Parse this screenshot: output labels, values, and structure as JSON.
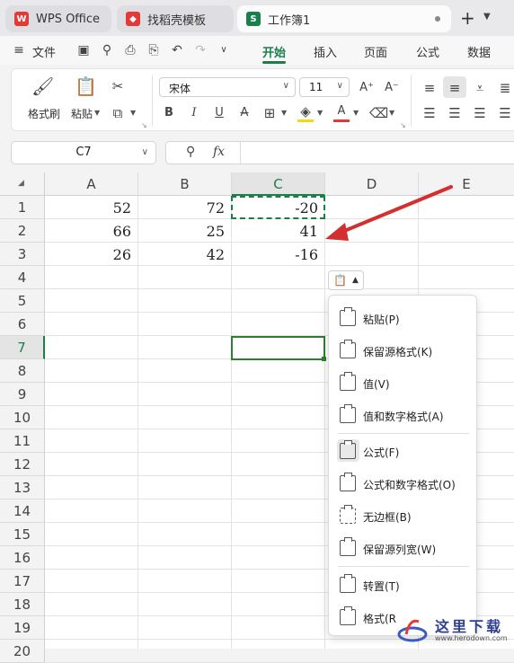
{
  "tabs": {
    "wps": "WPS Office",
    "template": "找稻壳模板",
    "workbook": "工作簿1",
    "workbook_logo": "S"
  },
  "menu": {
    "file": "文件",
    "items": [
      "开始",
      "插入",
      "页面",
      "公式",
      "数据"
    ],
    "active": "开始"
  },
  "ribbon": {
    "format_painter": "格式刷",
    "paste": "粘贴",
    "font_name": "宋体",
    "font_size": "11",
    "bold": "B",
    "italic": "I",
    "underline": "U",
    "strike": "A",
    "font_color_glyph": "A",
    "grow_font": "A⁺",
    "shrink_font": "A⁻"
  },
  "formula_bar": {
    "name_box": "C7",
    "fx": "fx",
    "formula": ""
  },
  "grid": {
    "columns": [
      "A",
      "B",
      "C",
      "D",
      "E"
    ],
    "rows": [
      "1",
      "2",
      "3",
      "4",
      "5",
      "6",
      "7",
      "8",
      "9",
      "10",
      "11",
      "12",
      "13",
      "14",
      "15",
      "16",
      "17",
      "18",
      "19",
      "20"
    ],
    "cells": {
      "A1": "52",
      "B1": "72",
      "C1": "-20",
      "A2": "66",
      "B2": "25",
      "C2": "41",
      "A3": "26",
      "B3": "42",
      "C3": "-16"
    },
    "active_cell": "C7",
    "copied_cell": "C1"
  },
  "paste_menu": {
    "items": [
      "粘贴(P)",
      "保留源格式(K)",
      "值(V)",
      "值和数字格式(A)",
      "公式(F)",
      "公式和数字格式(O)",
      "无边框(B)",
      "保留源列宽(W)",
      "转置(T)",
      "格式(R"
    ],
    "highlighted": "公式(F)"
  },
  "watermark": {
    "text": "这里下载",
    "url": "www.herodown.com"
  },
  "colors": {
    "accent_green": "#1a7f4b",
    "selection_green": "#2e7d32",
    "arrow_red": "#d32f2f",
    "font_color_red": "#e53935",
    "highlight_yellow": "#f5d90a"
  }
}
